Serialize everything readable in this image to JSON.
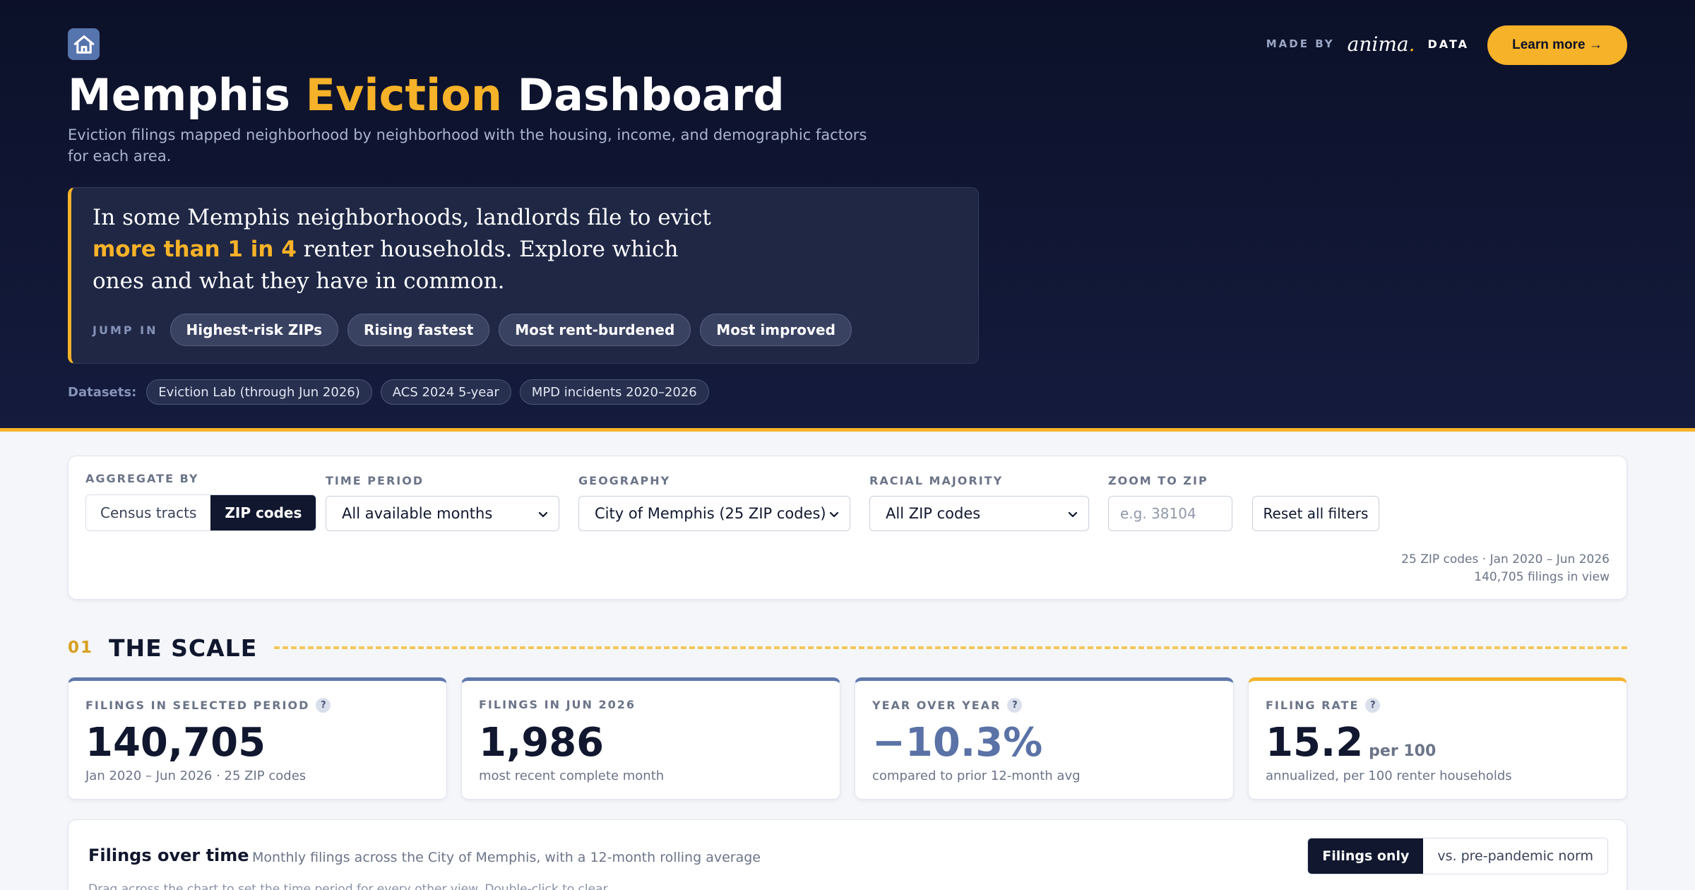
{
  "header": {
    "madeby_label": "MADE BY",
    "brand_name": "anima",
    "brand_dot": ".",
    "brand_data": "DATA",
    "learn_more": "Learn more →",
    "title_part1": "Memphis ",
    "title_highlight": "Eviction",
    "title_part2": " Dashboard",
    "subtitle": "Eviction filings mapped neighborhood by neighborhood with the housing, income, and demographic factors for each area."
  },
  "callout": {
    "text_part1": "In some Memphis neighborhoods, landlords file to evict ",
    "text_highlight": "more than 1 in 4",
    "text_part2": " renter households. Explore which ones and what they have in common.",
    "jump_label": "JUMP IN",
    "jump_links": [
      "Highest-risk ZIPs",
      "Rising fastest",
      "Most rent-burdened",
      "Most improved"
    ]
  },
  "datasets": {
    "label": "Datasets:",
    "items": [
      "Eviction Lab (through Jun 2026)",
      "ACS 2024 5-year",
      "MPD incidents 2020–2026"
    ]
  },
  "filters": {
    "aggregate": {
      "label": "AGGREGATE BY",
      "options": [
        "Census tracts",
        "ZIP codes"
      ],
      "selected": "ZIP codes"
    },
    "time_period": {
      "label": "TIME PERIOD",
      "value": "All available months"
    },
    "geography": {
      "label": "GEOGRAPHY",
      "value": "City of Memphis (25 ZIP codes)"
    },
    "racial_majority": {
      "label": "RACIAL MAJORITY",
      "value": "All ZIP codes"
    },
    "zoom": {
      "label": "ZOOM TO ZIP",
      "placeholder": "e.g. 38104"
    },
    "reset": "Reset all filters",
    "summary_line1": "25 ZIP codes · Jan 2020 – Jun 2026",
    "summary_line2": "140,705 filings in view"
  },
  "section": {
    "number": "01",
    "title": "THE SCALE"
  },
  "kpis": [
    {
      "label": "FILINGS IN SELECTED PERIOD",
      "value": "140,705",
      "unit": "",
      "sub": "Jan 2020 – Jun 2026 · 25 ZIP codes",
      "help": "?"
    },
    {
      "label": "FILINGS IN JUN 2026",
      "value": "1,986",
      "unit": "",
      "sub": "most recent complete month",
      "help": ""
    },
    {
      "label": "YEAR OVER YEAR",
      "value": "−10.3%",
      "unit": "",
      "sub": "compared to prior 12-month avg",
      "help": "?"
    },
    {
      "label": "FILING RATE",
      "value": "15.2",
      "unit": "per 100",
      "sub": "annualized, per 100 renter households",
      "help": "?"
    }
  ],
  "chart": {
    "title": "Filings over time",
    "description": "Monthly filings across the City of Memphis, with a 12-month rolling average",
    "hint": "Drag across the chart to set the time period for every other view. Double-click to clear.",
    "toggle": [
      "Filings only",
      "vs. pre-pandemic norm"
    ],
    "toggle_selected": "Filings only"
  },
  "colors": {
    "hero_bg": "#0c1129",
    "accent_gold": "#f6b228",
    "kpi_blue": "#5f78ad",
    "text_dark": "#10172e"
  },
  "icons": {
    "home": "home-icon",
    "chevron": "chevron-down-icon",
    "help": "help-icon"
  }
}
